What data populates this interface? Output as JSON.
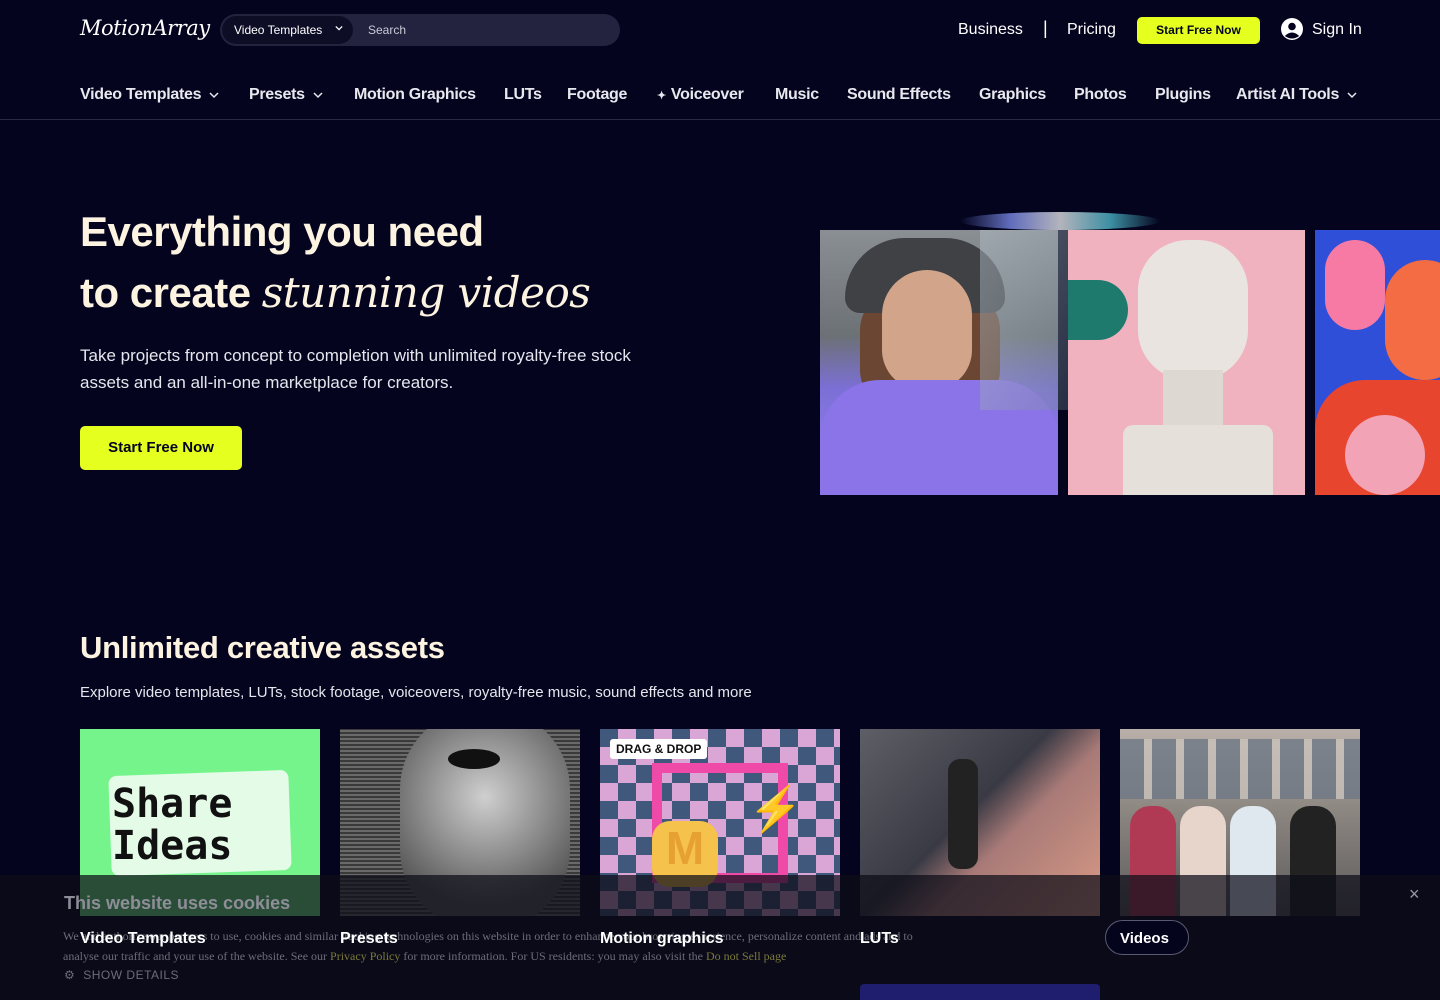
{
  "header": {
    "logo": "MotionArray",
    "search": {
      "category": "Video Templates",
      "placeholder": "Search"
    },
    "business": "Business",
    "separator": "|",
    "pricing": "Pricing",
    "cta": "Start Free Now",
    "sign_in": "Sign In"
  },
  "nav": {
    "items": [
      {
        "label": "Video Templates",
        "dropdown": true
      },
      {
        "label": "Presets",
        "dropdown": true
      },
      {
        "label": "Motion Graphics"
      },
      {
        "label": "LUTs"
      },
      {
        "label": "Footage"
      },
      {
        "label": "Voiceover",
        "icon": "sparkle-icon"
      },
      {
        "label": "Music"
      },
      {
        "label": "Sound Effects"
      },
      {
        "label": "Graphics"
      },
      {
        "label": "Photos"
      },
      {
        "label": "Plugins"
      },
      {
        "label": "Artist AI Tools",
        "dropdown": true
      }
    ]
  },
  "hero": {
    "line1": "Everything you need",
    "line2_plain": "to create ",
    "line2_italic": "stunning videos",
    "subtitle": "Take projects from concept to completion with unlimited royalty-free stock assets and an all-in-one marketplace for creators.",
    "cta": "Start Free Now"
  },
  "assets": {
    "title": "Unlimited creative assets",
    "subtitle": "Explore video templates, LUTs, stock footage, voiceovers, royalty-free music, sound effects and more",
    "cards": [
      {
        "label": "Video Templates",
        "art_text_1": "Share",
        "art_text_2": "Ideas"
      },
      {
        "label": "Presets"
      },
      {
        "label": "Motion graphics",
        "tag": "DRAG & DROP",
        "art_letter": "M"
      },
      {
        "label": "LUTs"
      },
      {
        "label": "Videos"
      }
    ]
  },
  "cookie": {
    "title": "This website uses cookies",
    "text_before": "We and authorize our partners to use, cookies and similar tracking technologies on this website in order to enhance your browsing experience, personalize content and ads and to analyse our traffic and your use of the website. See our ",
    "privacy_link": "Privacy Policy",
    "text_middle": " for more information. For US residents: you may also visit the ",
    "dns_link": "Do not Sell page",
    "text_after": "",
    "show_details": "SHOW DETAILS",
    "close": "×"
  },
  "colors": {
    "background": "#04041e",
    "accent": "#e5ff1f",
    "heading": "#fdf3e1"
  }
}
